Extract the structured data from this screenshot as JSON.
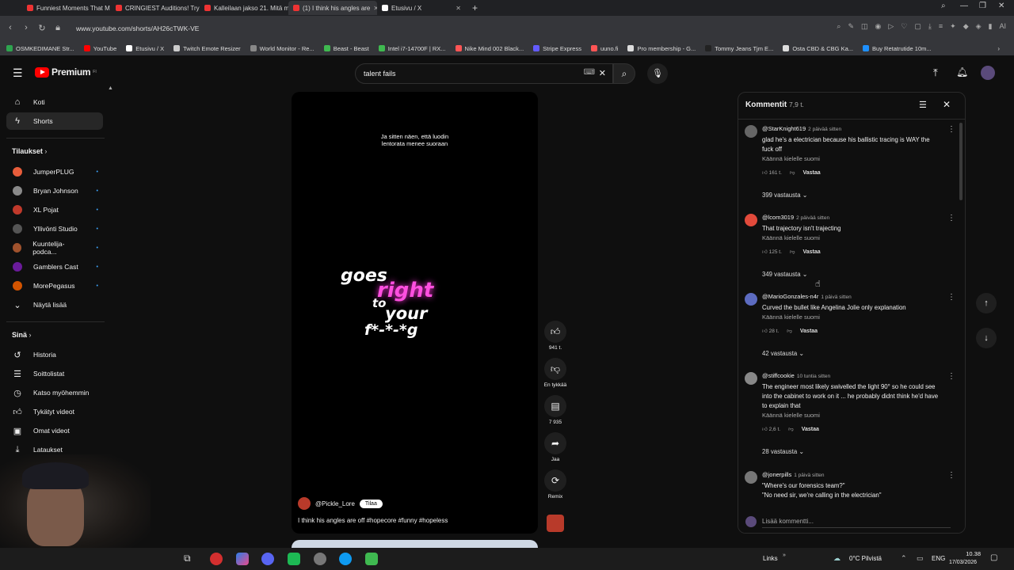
{
  "browser": {
    "tabs": [
      {
        "title": "Funniest Moments That M",
        "active": false,
        "fav": "youtube"
      },
      {
        "title": "CRINGIEST Auditions! Try",
        "active": false,
        "fav": "youtube"
      },
      {
        "title": "Kalleilaan jakso 21. Mitä m",
        "active": false,
        "fav": "youtube"
      },
      {
        "title": "(1) I think his angles are",
        "active": true,
        "fav": "youtube"
      },
      {
        "title": "Etusivu / X",
        "active": false,
        "fav": "x"
      }
    ],
    "url": "www.youtube.com/shorts/AH26cTWK-VE",
    "bookmarks": [
      {
        "label": "OSMKEDIMANE Str...",
        "color": "#2ea44f"
      },
      {
        "label": "YouTube",
        "color": "#ff0000"
      },
      {
        "label": "Etusivu / X",
        "color": "#ffffff"
      },
      {
        "label": "Twitch Emote Resizer",
        "color": "#cccccc"
      },
      {
        "label": "World Monitor - Re...",
        "color": "#888888"
      },
      {
        "label": "Beast - Beast",
        "color": "#3fb950"
      },
      {
        "label": "Intel i7-14700F | RX...",
        "color": "#3fb950"
      },
      {
        "label": "Nike Mind 002 Black...",
        "color": "#ff5555"
      },
      {
        "label": "Stripe Express",
        "color": "#635bff"
      },
      {
        "label": "uuno.fi",
        "color": "#ff5555"
      },
      {
        "label": "Pro membership - G...",
        "color": "#dddddd"
      },
      {
        "label": "Tommy Jeans Tjm E...",
        "color": "#222222"
      },
      {
        "label": "Osta CBD & CBG Ka...",
        "color": "#dddddd"
      },
      {
        "label": "Buy Retatrutide 10m...",
        "color": "#1e90ff"
      }
    ]
  },
  "youtube": {
    "logo_text": "Premium",
    "logo_sup": "FI",
    "search_value": "talent fails"
  },
  "sidebar": {
    "home": "Koti",
    "shorts": "Shorts",
    "subscriptions_heading": "Tilaukset",
    "subscriptions": [
      {
        "name": "JumperPLUG",
        "color": "#e85d3b"
      },
      {
        "name": "Bryan Johnson",
        "color": "#8a8a8a"
      },
      {
        "name": "XL Pojat",
        "color": "#c0392b"
      },
      {
        "name": "Yllivönti Studio",
        "color": "#555555"
      },
      {
        "name": "Kuuntelija-podca...",
        "color": "#a0522d"
      },
      {
        "name": "Gamblers Cast",
        "color": "#6a1b9a"
      },
      {
        "name": "MorePegasus",
        "color": "#d35400"
      }
    ],
    "show_more": "Näytä lisää",
    "you_heading": "Sinä",
    "you_items": [
      "Historia",
      "Soittolistat",
      "Katso myöhemmin",
      "Tykätyt videot",
      "Omat videot",
      "Lataukset"
    ]
  },
  "video": {
    "subtitle_line1": "Ja sitten näen, että luodin",
    "subtitle_line2": "lentorata menee suoraan",
    "words": [
      "goes",
      "right",
      "to",
      "your",
      "f*-*-*g"
    ],
    "channel": "@Pickle_Lore",
    "subscribe": "Tilaa",
    "caption": "I think his angles are off #hopecore #funny #hopeless"
  },
  "actions": {
    "likes": "941 t.",
    "dislike": "En tykkää",
    "comments": "7 935",
    "share": "Jaa",
    "remix": "Remix"
  },
  "comments_panel": {
    "title": "Kommentit",
    "count": "7,9 t.",
    "add_placeholder": "Lisää kommentti...",
    "translate": "Käännä kielelle suomi",
    "reply_label": "Vastaa",
    "items": [
      {
        "author": "@StarKnight619",
        "ago": "2 päivää sitten",
        "lines": [
          "glad he's a electrician because his ballistic tracing is WAY the",
          "fuck off"
        ],
        "likes": "161 t.",
        "replies": "399 vastausta"
      },
      {
        "author": "@lcom3019",
        "ago": "2 päivää sitten",
        "lines": [
          "That trajectory isn't trajecting"
        ],
        "likes": "125 t.",
        "replies": "349 vastausta"
      },
      {
        "author": "@MarioGonzales-n4r",
        "ago": "1 päivä sitten",
        "lines": [
          "Curved the bullet like Angelina Jolie only explanation"
        ],
        "likes": "28 t.",
        "replies": "42 vastausta"
      },
      {
        "author": "@stiffcookie",
        "ago": "10 tuntia sitten",
        "lines": [
          "The engineer most likely swivelled the light 90° so he could see",
          "into the cabinet to work on it ... he probably didnt think he'd have",
          "to explain that"
        ],
        "likes": "2,6 t.",
        "replies": "28 vastausta"
      },
      {
        "author": "@jonerpills",
        "ago": "1 päivä sitten",
        "lines": [
          "\"Where's our forensics team?\"",
          "\"No need sir, we're calling in the electrician\""
        ],
        "likes": "",
        "replies": ""
      }
    ]
  },
  "taskbar": {
    "links": "Links",
    "weather": "0°C  Pilvistä",
    "lang": "ENG",
    "time": "10.38",
    "date": "17/03/2026"
  }
}
